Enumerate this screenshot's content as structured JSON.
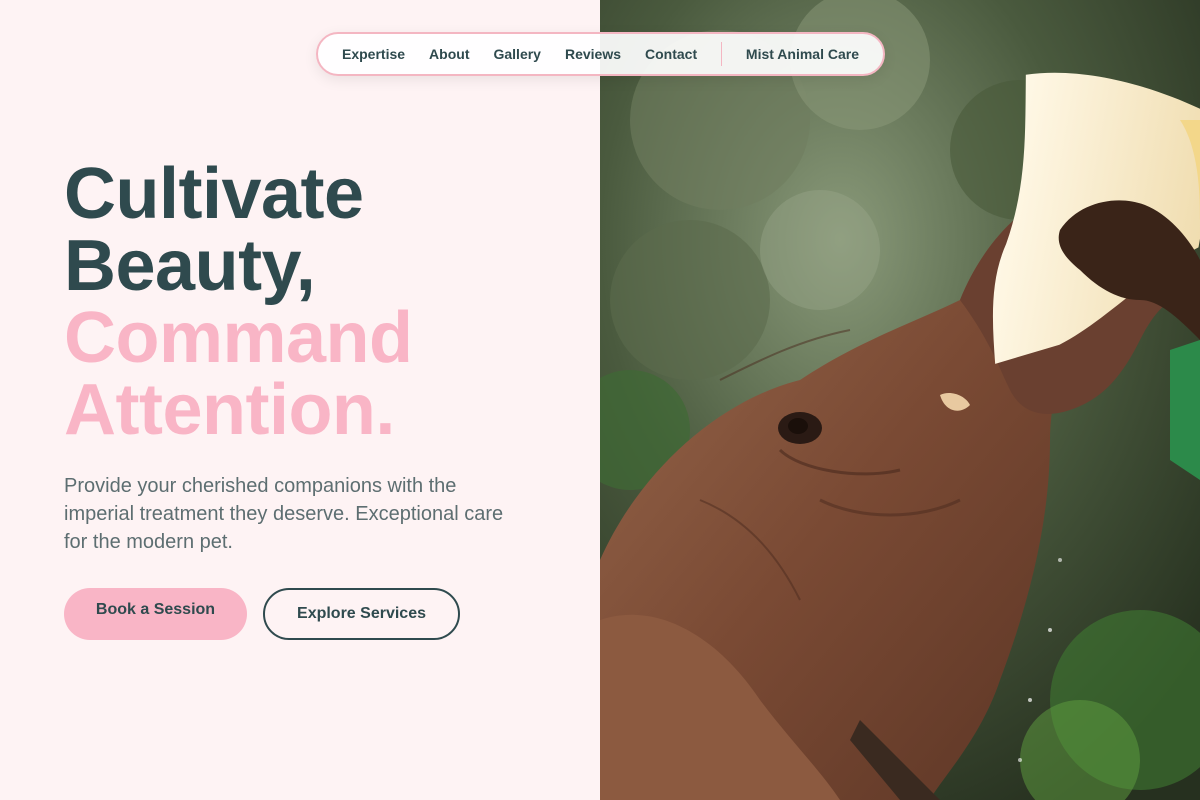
{
  "nav": {
    "links": [
      "Expertise",
      "About",
      "Gallery",
      "Reviews",
      "Contact"
    ],
    "brand": "Mist Animal Care"
  },
  "hero": {
    "line1": "Cultivate",
    "line2": "Beauty,",
    "line3": "Command",
    "line4": "Attention.",
    "subtitle": "Provide your cherished companions with the imperial treatment they deserve. Exceptional care for the modern pet.",
    "primary_cta": "Book a Session",
    "secondary_cta": "Explore Services"
  },
  "colors": {
    "background": "#fef3f4",
    "dark_text": "#2f4a4e",
    "accent_pink": "#f9b5c6",
    "nav_border": "#f4b6c2"
  },
  "image": {
    "icon": "elephant-feeding-photo"
  }
}
